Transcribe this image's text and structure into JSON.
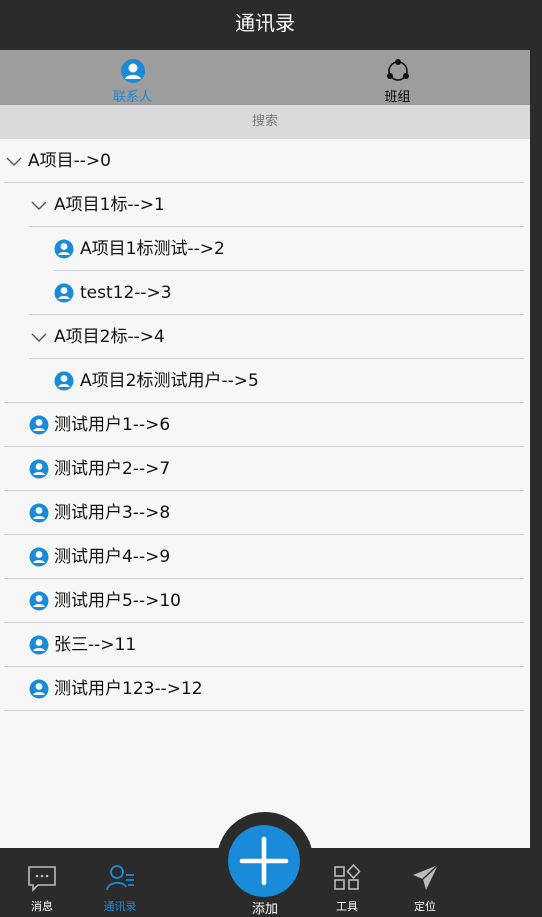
{
  "header": {
    "title": "通讯录"
  },
  "tabs": [
    {
      "label": "联系人",
      "icon": "contact-person-icon",
      "active": true
    },
    {
      "label": "班组",
      "icon": "share-group-icon",
      "active": false
    }
  ],
  "search": {
    "placeholder": "搜索"
  },
  "tree": [
    {
      "label": "A项目-->0",
      "kind": "group",
      "depth": 0
    },
    {
      "label": "A项目1标-->1",
      "kind": "group",
      "depth": 1
    },
    {
      "label": "A项目1标测试-->2",
      "kind": "user",
      "depth": 2
    },
    {
      "label": "test12-->3",
      "kind": "user",
      "depth": 2
    },
    {
      "label": "A项目2标-->4",
      "kind": "group",
      "depth": 1
    },
    {
      "label": "A项目2标测试用户-->5",
      "kind": "user",
      "depth": 2
    },
    {
      "label": "测试用户1-->6",
      "kind": "user",
      "depth": 1
    },
    {
      "label": "测试用户2-->7",
      "kind": "user",
      "depth": 1
    },
    {
      "label": "测试用户3-->8",
      "kind": "user",
      "depth": 1
    },
    {
      "label": "测试用户4-->9",
      "kind": "user",
      "depth": 1
    },
    {
      "label": "测试用户5-->10",
      "kind": "user",
      "depth": 1
    },
    {
      "label": "张三-->11",
      "kind": "user",
      "depth": 1
    },
    {
      "label": "测试用户123-->12",
      "kind": "user",
      "depth": 1
    }
  ],
  "bottom_nav": [
    {
      "label": "消息",
      "icon": "message-icon",
      "active": false
    },
    {
      "label": "通讯录",
      "icon": "contacts-icon",
      "active": true
    },
    {
      "label": "添加",
      "icon": "add-icon",
      "active": false
    },
    {
      "label": "工具",
      "icon": "tools-icon",
      "active": false
    },
    {
      "label": "定位",
      "icon": "location-send-icon",
      "active": false
    }
  ],
  "colors": {
    "accent": "#1a8bd8",
    "bar": "#2b2b2b",
    "tab_bg": "#9d9d9d"
  }
}
